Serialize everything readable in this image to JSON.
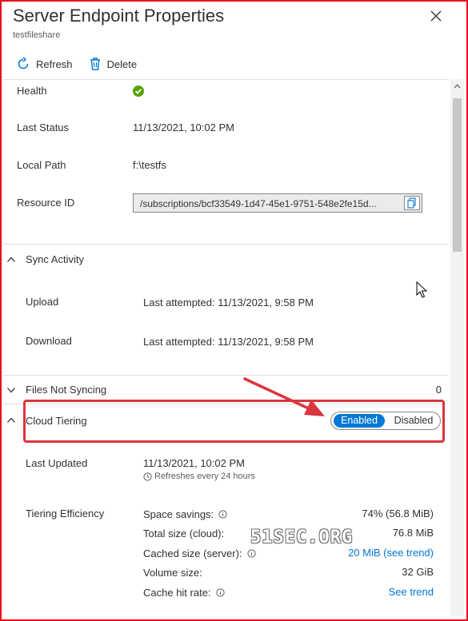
{
  "header": {
    "title": "Server Endpoint Properties",
    "subtitle": "testfileshare"
  },
  "toolbar": {
    "refresh": "Refresh",
    "delete": "Delete"
  },
  "details": {
    "health_label": "Health",
    "last_status_label": "Last Status",
    "last_status_value": "11/13/2021, 10:02 PM",
    "local_path_label": "Local Path",
    "local_path_value": "f:\\testfs",
    "resource_id_label": "Resource ID",
    "resource_id_value": "/subscriptions/bcf33549-1d47-45e1-9751-548e2fe15d..."
  },
  "sync_activity": {
    "title": "Sync Activity",
    "upload_label": "Upload",
    "upload_value": "Last attempted: 11/13/2021, 9:58 PM",
    "download_label": "Download",
    "download_value": "Last attempted: 11/13/2021, 9:58 PM"
  },
  "files_not_syncing": {
    "title": "Files Not Syncing",
    "count": "0"
  },
  "cloud_tiering": {
    "title": "Cloud Tiering",
    "toggle_enabled": "Enabled",
    "toggle_disabled": "Disabled",
    "last_updated_label": "Last Updated",
    "last_updated_value": "11/13/2021, 10:02 PM",
    "refresh_note": "Refreshes every 24 hours",
    "efficiency_label": "Tiering Efficiency",
    "metrics": {
      "space_savings_label": "Space savings:",
      "space_savings_value": "74% (56.8 MiB)",
      "total_size_label": "Total size (cloud):",
      "total_size_value": "76.8 MiB",
      "cached_size_label": "Cached size (server):",
      "cached_size_value": "20 MiB (see trend)",
      "volume_size_label": "Volume size:",
      "volume_size_value": "32 GiB",
      "cache_hit_label": "Cache hit rate:",
      "cache_hit_value": "See trend"
    }
  },
  "watermark": "51SEC.ORG",
  "colors": {
    "accent": "#0078d4",
    "health_ok": "#57a300",
    "annotation_red": "#d9363e"
  }
}
